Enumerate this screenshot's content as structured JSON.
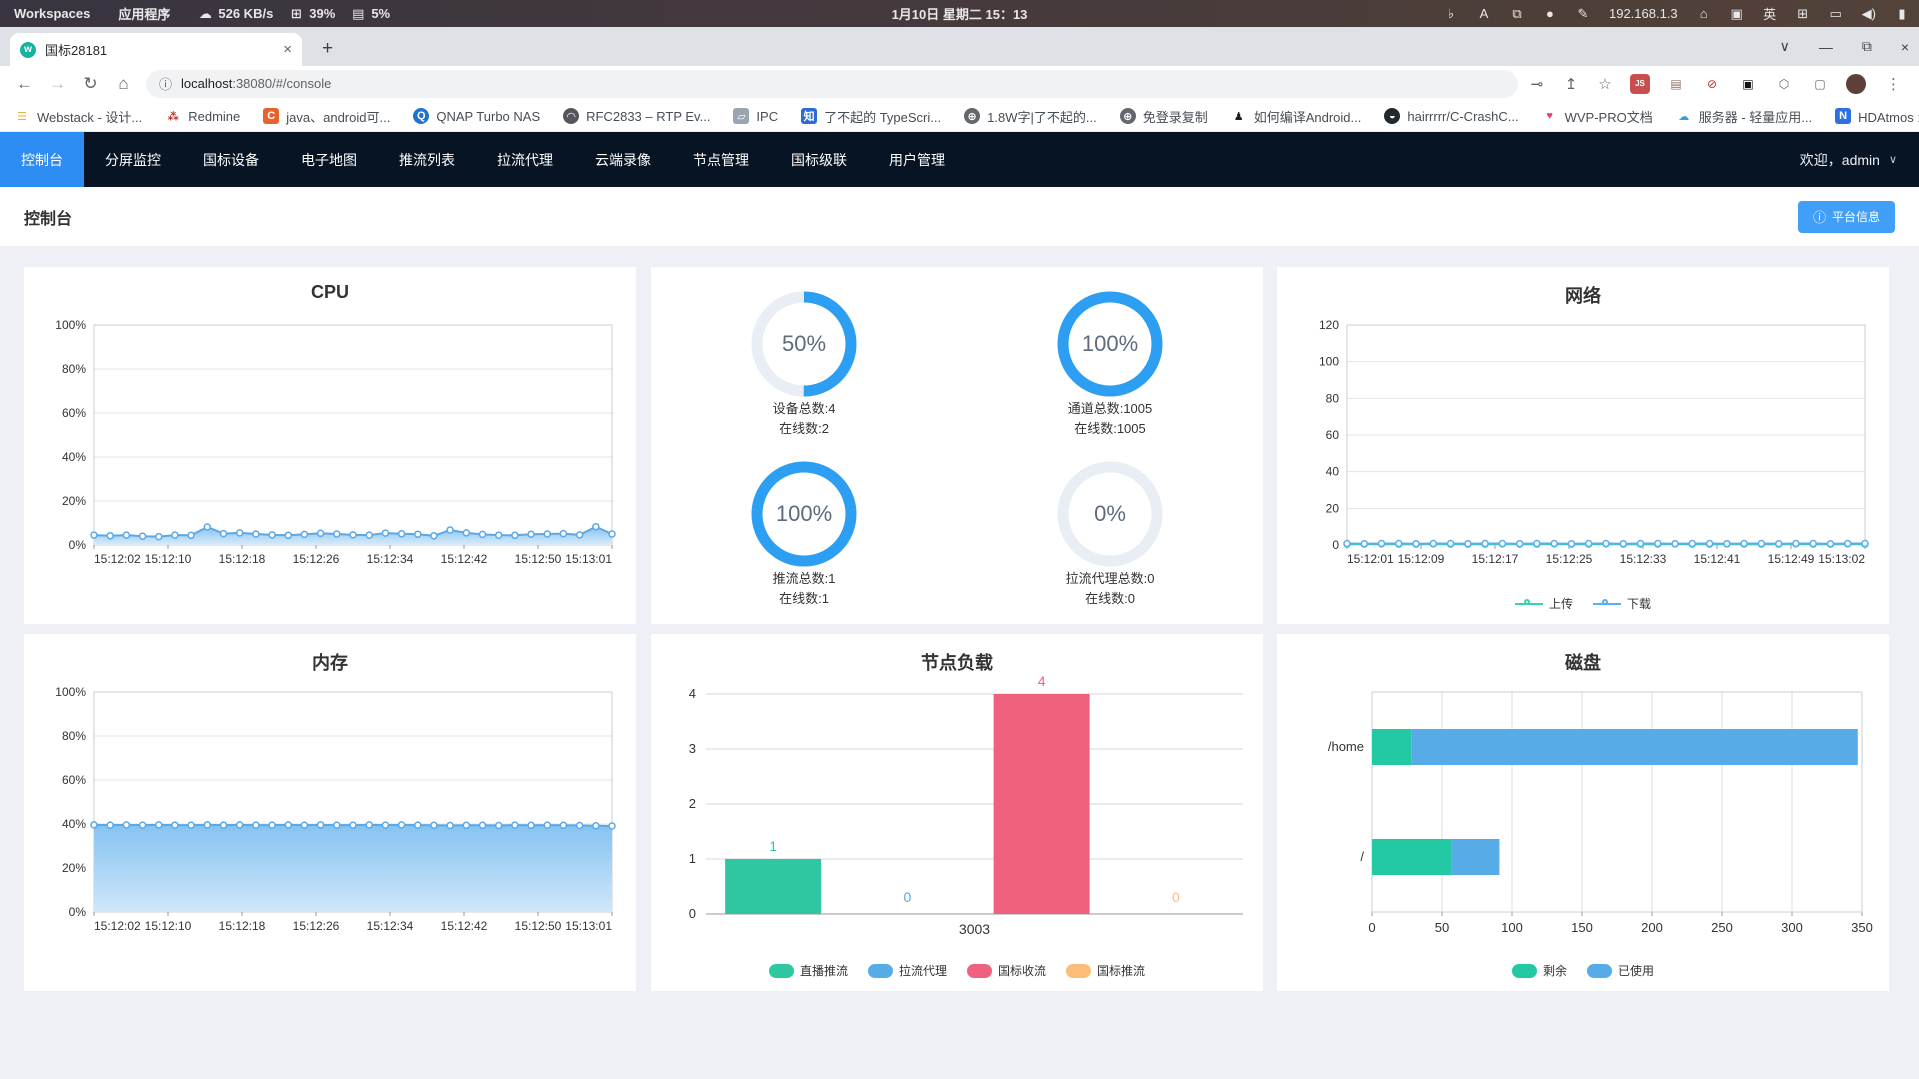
{
  "system_bar": {
    "workspaces_label": "Workspaces",
    "applications_label": "应用程序",
    "indicators": [
      {
        "name": "network-speed-indicator",
        "icon": "☁",
        "label": "526 KB/s"
      },
      {
        "name": "cpu-usage-indicator",
        "icon": "⊞",
        "label": "39%"
      },
      {
        "name": "memory-usage-indicator",
        "icon": "▤",
        "label": "5%"
      }
    ],
    "clock": "1月10日 星期二 15：13",
    "right_icons": [
      {
        "name": "bing-icon",
        "glyph": "♭"
      },
      {
        "name": "screenshot-tool-icon",
        "glyph": "A"
      },
      {
        "name": "clipboard-manager-icon",
        "glyph": "⧉"
      },
      {
        "name": "jar-applet-icon",
        "glyph": "●"
      },
      {
        "name": "color-picker-icon",
        "glyph": "✎"
      },
      {
        "name": "ip-address-indicator",
        "glyph": "192.168.1.3"
      },
      {
        "name": "home-icon",
        "glyph": "⌂"
      },
      {
        "name": "window-stack-icon",
        "glyph": "▣"
      },
      {
        "name": "input-method-indicator",
        "glyph": "英"
      },
      {
        "name": "virtual-desktop-icon",
        "glyph": "⊞"
      },
      {
        "name": "display-icon",
        "glyph": "▭"
      },
      {
        "name": "volume-icon",
        "glyph": "◀)"
      },
      {
        "name": "battery-icon",
        "glyph": "▮"
      }
    ]
  },
  "browser": {
    "tab_title": "国标28181",
    "tab_favicon_glyph": "w",
    "tab_close_glyph": "×",
    "new_tab_glyph": "+",
    "window_controls": [
      {
        "name": "tab-search-chevron",
        "glyph": "∨"
      },
      {
        "name": "minimize-button",
        "glyph": "—"
      },
      {
        "name": "restore-button",
        "glyph": "⧉"
      },
      {
        "name": "close-button",
        "glyph": "×"
      }
    ],
    "nav_icons": [
      {
        "name": "back-icon",
        "glyph": "←",
        "enabled": true
      },
      {
        "name": "forward-icon",
        "glyph": "→",
        "enabled": false
      },
      {
        "name": "reload-icon",
        "glyph": "↻",
        "enabled": true
      },
      {
        "name": "home-icon",
        "glyph": "⌂",
        "enabled": true
      }
    ],
    "url": {
      "info_icon": "ⓘ",
      "host": "localhost",
      "rest": ":38080/#/console"
    },
    "action_icons": [
      {
        "name": "key-icon",
        "glyph": "⊸"
      },
      {
        "name": "share-icon",
        "glyph": "↥"
      },
      {
        "name": "bookmark-star-icon",
        "glyph": "☆"
      }
    ],
    "extensions": [
      {
        "name": "ext-js-icon",
        "glyph": "JS",
        "fg": "#ffffff",
        "bg": "#c94f4f",
        "cls": "js"
      },
      {
        "name": "ext-printer-icon",
        "glyph": "▤",
        "fg": "#8d6e63",
        "bg": "",
        "cls": ""
      },
      {
        "name": "ext-blocker-icon",
        "glyph": "⊘",
        "fg": "#c62828",
        "bg": "",
        "cls": ""
      },
      {
        "name": "ext-dark-square-icon",
        "glyph": "▣",
        "fg": "#111111",
        "bg": "",
        "cls": ""
      },
      {
        "name": "ext-puzzle-icon",
        "glyph": "⬡",
        "fg": "#5f6368",
        "bg": "",
        "cls": ""
      },
      {
        "name": "ext-box-icon",
        "glyph": "▢",
        "fg": "#5f6368",
        "bg": "",
        "cls": ""
      },
      {
        "name": "profile-avatar",
        "glyph": "",
        "fg": "#ffffff",
        "bg": "#5d4037",
        "cls": "round"
      },
      {
        "name": "browser-menu-kebab",
        "glyph": "⋮",
        "fg": "#5f6368",
        "bg": "",
        "cls": ""
      }
    ],
    "bookmarks": [
      {
        "label": "Webstack - 设计...",
        "glyph": "☰",
        "fg": "#e9b23d",
        "bg": "",
        "round": false
      },
      {
        "label": "Redmine",
        "glyph": "⁂",
        "fg": "#b5352b",
        "bg": "",
        "round": false
      },
      {
        "label": "java、android可...",
        "glyph": "C",
        "fg": "#ffffff",
        "bg": "#e8622d",
        "round": false
      },
      {
        "label": "QNAP Turbo NAS",
        "glyph": "Q",
        "fg": "#ffffff",
        "bg": "#2273cf",
        "round": true
      },
      {
        "label": "RFC2833 – RTP Ev...",
        "glyph": "◠",
        "fg": "#ffffff",
        "bg": "#56565e",
        "round": true
      },
      {
        "label": "IPC",
        "glyph": "▱",
        "fg": "#ffffff",
        "bg": "#9aa5b1",
        "round": false
      },
      {
        "label": "了不起的 TypeScri...",
        "glyph": "知",
        "fg": "#ffffff",
        "bg": "#2b6bd3",
        "round": false
      },
      {
        "label": "1.8W字|了不起的...",
        "glyph": "⊕",
        "fg": "#ffffff",
        "bg": "#63666c",
        "round": true
      },
      {
        "label": "免登录复制",
        "glyph": "⊕",
        "fg": "#ffffff",
        "bg": "#63666c",
        "round": true
      },
      {
        "label": "如何编译Android...",
        "glyph": "♟",
        "fg": "#1d1d22",
        "bg": "",
        "round": false
      },
      {
        "label": "hairrrrr/C-CrashC...",
        "glyph": "◒",
        "fg": "#ffffff",
        "bg": "#24292f",
        "round": true
      },
      {
        "label": "WVP-PRO文档",
        "glyph": "♥",
        "fg": "#e0457b",
        "bg": "",
        "round": false
      },
      {
        "label": "服务器 - 轻量应用...",
        "glyph": "☁",
        "fg": "#3d9be2",
        "bg": "",
        "round": false
      },
      {
        "label": "HDAtmos :: 种子 *...",
        "glyph": "N",
        "fg": "#ffffff",
        "bg": "#2f6fe4",
        "round": false
      }
    ],
    "bookmarks_overflow_glyph": "»"
  },
  "nav": {
    "items": [
      "控制台",
      "分屏监控",
      "国标设备",
      "电子地图",
      "推流列表",
      "拉流代理",
      "云端录像",
      "节点管理",
      "国标级联",
      "用户管理"
    ],
    "active_index": 0,
    "welcome": "欢迎，admin",
    "welcome_chevron": "∨"
  },
  "page": {
    "title": "控制台",
    "platform_info_icon": "ⓘ",
    "platform_info_label": "平台信息"
  },
  "stats_panel": {
    "ring_color": "#2d9ff2",
    "track_color": "#e9edf4",
    "items": [
      {
        "percent_label": "50%",
        "fraction": 0.5,
        "line1": "设备总数:4",
        "line2": "在线数:2"
      },
      {
        "percent_label": "100%",
        "fraction": 1,
        "line1": "通道总数:1005",
        "line2": "在线数:1005"
      },
      {
        "percent_label": "100%",
        "fraction": 1,
        "line1": "推流总数:1",
        "line2": "在线数:1"
      },
      {
        "percent_label": "0%",
        "fraction": 0,
        "line1": "拉流代理总数:0",
        "line2": "在线数:0"
      }
    ]
  },
  "chart_data": [
    {
      "id": "cpu",
      "type": "line",
      "title": "CPU",
      "ylim": [
        0,
        100
      ],
      "yticks": [
        0,
        20,
        40,
        60,
        80,
        100
      ],
      "y_suffix": "%",
      "x_labels": [
        "15:12:02",
        "15:12:10",
        "15:12:18",
        "15:12:26",
        "15:12:34",
        "15:12:42",
        "15:12:50",
        "15:13:01"
      ],
      "series": [
        {
          "name": "CPU",
          "color": "#5ba7e8",
          "area": [
            "#86c3f1",
            "#d8ecfb"
          ],
          "values": [
            4.5,
            4.2,
            4.5,
            4.0,
            3.8,
            4.5,
            4.4,
            8.2,
            5.2,
            5.5,
            5.0,
            4.6,
            4.4,
            4.8,
            5.3,
            5.0,
            4.6,
            4.5,
            5.4,
            5.1,
            4.9,
            4.2,
            6.8,
            5.5,
            4.8,
            4.5,
            4.4,
            4.9,
            5.0,
            5.2,
            4.6,
            8.3,
            5.0
          ]
        }
      ]
    },
    {
      "id": "network",
      "type": "line",
      "title": "网络",
      "ylim": [
        0,
        120
      ],
      "yticks": [
        0,
        20,
        40,
        60,
        80,
        100,
        120
      ],
      "y_suffix": "",
      "x_labels": [
        "15:12:01",
        "15:12:09",
        "15:12:17",
        "15:12:25",
        "15:12:33",
        "15:12:41",
        "15:12:49",
        "15:13:02"
      ],
      "legend": "line",
      "series": [
        {
          "name": "上传",
          "color": "#3ad2ae",
          "values": [
            0.5,
            0.5,
            0.6,
            0.5,
            0.5,
            0.6,
            0.5,
            0.5,
            0.5,
            0.6,
            0.5,
            0.5,
            0.6,
            0.5,
            0.5,
            0.6,
            0.5,
            0.5,
            0.5,
            0.6,
            0.5,
            0.5,
            0.6,
            0.5,
            0.5,
            0.5,
            0.6,
            0.5,
            0.5,
            0.6,
            0.5
          ]
        },
        {
          "name": "下载",
          "color": "#59aef0",
          "values": [
            0.8,
            0.7,
            0.8,
            0.8,
            0.7,
            0.8,
            0.8,
            0.7,
            0.8,
            0.8,
            0.7,
            0.8,
            0.8,
            0.7,
            0.8,
            0.8,
            0.7,
            0.8,
            0.8,
            0.7,
            0.8,
            0.8,
            0.7,
            0.8,
            0.8,
            0.7,
            0.8,
            0.8,
            0.7,
            0.8,
            0.8
          ]
        }
      ]
    },
    {
      "id": "memory",
      "type": "line",
      "title": "内存",
      "ylim": [
        0,
        100
      ],
      "yticks": [
        0,
        20,
        40,
        60,
        80,
        100
      ],
      "y_suffix": "%",
      "x_labels": [
        "15:12:02",
        "15:12:10",
        "15:12:18",
        "15:12:26",
        "15:12:34",
        "15:12:42",
        "15:12:50",
        "15:13:01"
      ],
      "series": [
        {
          "name": "内存",
          "color": "#5ba7e8",
          "area": [
            "#86c3f1",
            "#cfe7fa"
          ],
          "values": [
            39.6,
            39.5,
            39.6,
            39.5,
            39.6,
            39.5,
            39.5,
            39.6,
            39.5,
            39.6,
            39.5,
            39.5,
            39.6,
            39.5,
            39.6,
            39.5,
            39.5,
            39.6,
            39.5,
            39.6,
            39.5,
            39.4,
            39.3,
            39.4,
            39.4,
            39.3,
            39.5,
            39.4,
            39.5,
            39.4,
            39.3,
            39.2,
            39.1
          ]
        }
      ]
    },
    {
      "id": "load",
      "type": "bar",
      "title": "节点负载",
      "ylim": [
        0,
        4
      ],
      "yticks": [
        0,
        1,
        2,
        3,
        4
      ],
      "category": "3003",
      "legend": "chip",
      "series": [
        {
          "name": "直播推流",
          "color": "#2fc7a2",
          "value": 1
        },
        {
          "name": "拉流代理",
          "color": "#57ace8",
          "value": 0
        },
        {
          "name": "国标收流",
          "color": "#ef617c",
          "value": 4
        },
        {
          "name": "国标推流",
          "color": "#fcbd7a",
          "value": 0
        }
      ]
    },
    {
      "id": "disk",
      "type": "hbar",
      "title": "磁盘",
      "xlim": [
        0,
        350
      ],
      "xticks": [
        0,
        50,
        100,
        150,
        200,
        250,
        300,
        350
      ],
      "categories": [
        "/home",
        "/"
      ],
      "legend": "chip",
      "series": [
        {
          "name": "剩余",
          "color": "#22c9a2",
          "values": [
            28,
            57
          ]
        },
        {
          "name": "已使用",
          "color": "#57ace8",
          "values": [
            319,
            34
          ]
        }
      ]
    }
  ]
}
